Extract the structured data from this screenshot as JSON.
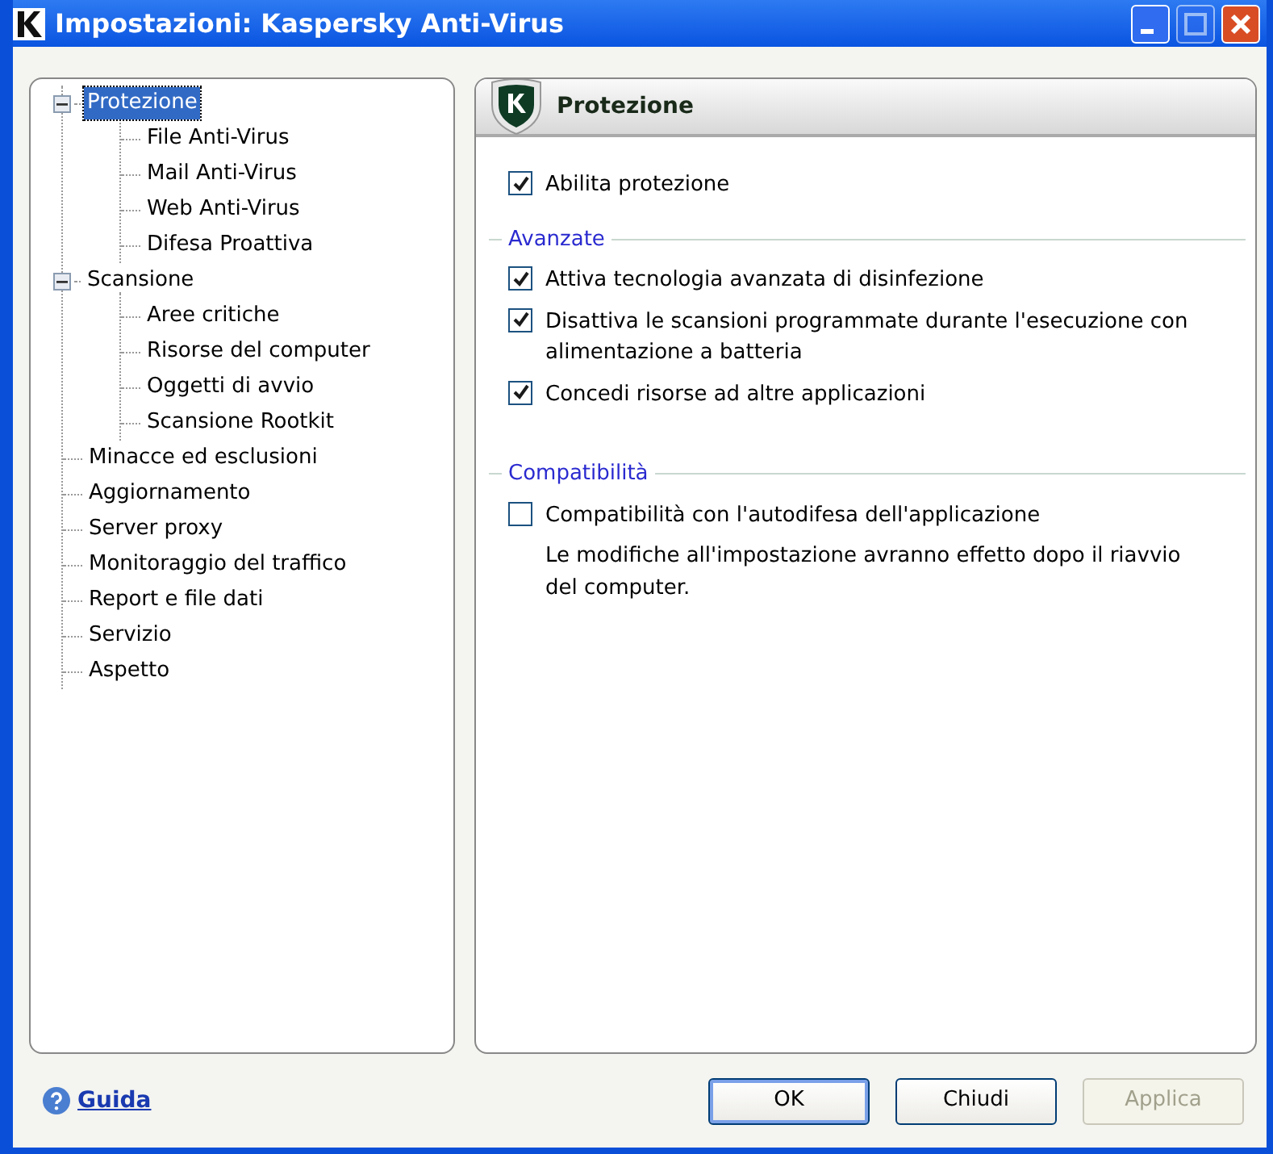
{
  "window": {
    "title": "Impostazioni: Kaspersky Anti-Virus"
  },
  "tree": [
    {
      "label": "Protezione",
      "selected": true,
      "expanded": true,
      "children": [
        {
          "label": "File Anti-Virus",
          "selected": false
        },
        {
          "label": "Mail Anti-Virus",
          "selected": false
        },
        {
          "label": "Web Anti-Virus",
          "selected": false
        },
        {
          "label": "Difesa Proattiva",
          "selected": false
        }
      ]
    },
    {
      "label": "Scansione",
      "selected": false,
      "expanded": true,
      "children": [
        {
          "label": "Aree critiche",
          "selected": false
        },
        {
          "label": "Risorse del computer",
          "selected": false
        },
        {
          "label": "Oggetti di avvio",
          "selected": false
        },
        {
          "label": "Scansione Rootkit",
          "selected": false
        }
      ]
    },
    {
      "label": "Minacce ed esclusioni",
      "selected": false
    },
    {
      "label": "Aggiornamento",
      "selected": false
    },
    {
      "label": "Server proxy",
      "selected": false
    },
    {
      "label": "Monitoraggio del traffico",
      "selected": false
    },
    {
      "label": "Report e file dati",
      "selected": false
    },
    {
      "label": "Servizio",
      "selected": false
    },
    {
      "label": "Aspetto",
      "selected": false
    }
  ],
  "panel": {
    "title": "Protezione",
    "options": [
      {
        "label": "Abilita protezione",
        "checked": true
      }
    ],
    "groups": [
      {
        "title": "Avanzate",
        "options": [
          {
            "label": "Attiva tecnologia avanzata di disinfezione",
            "checked": true
          },
          {
            "label": "Disattiva le scansioni programmate durante l'esecuzione con alimentazione a batteria",
            "checked": true
          },
          {
            "label": "Concedi risorse ad altre applicazioni",
            "checked": true
          }
        ]
      },
      {
        "title": "Compatibilità",
        "options": [
          {
            "label": "Compatibilità con l'autodifesa dell'applicazione",
            "checked": false
          }
        ],
        "note": "Le modifiche all'impostazione avranno effetto dopo il riavvio del computer."
      }
    ]
  },
  "help_link": "Guida",
  "buttons": [
    {
      "label": "OK",
      "default": true,
      "disabled": false
    },
    {
      "label": "Chiudi",
      "default": false,
      "disabled": false
    },
    {
      "label": "Applica",
      "default": false,
      "disabled": true
    }
  ]
}
